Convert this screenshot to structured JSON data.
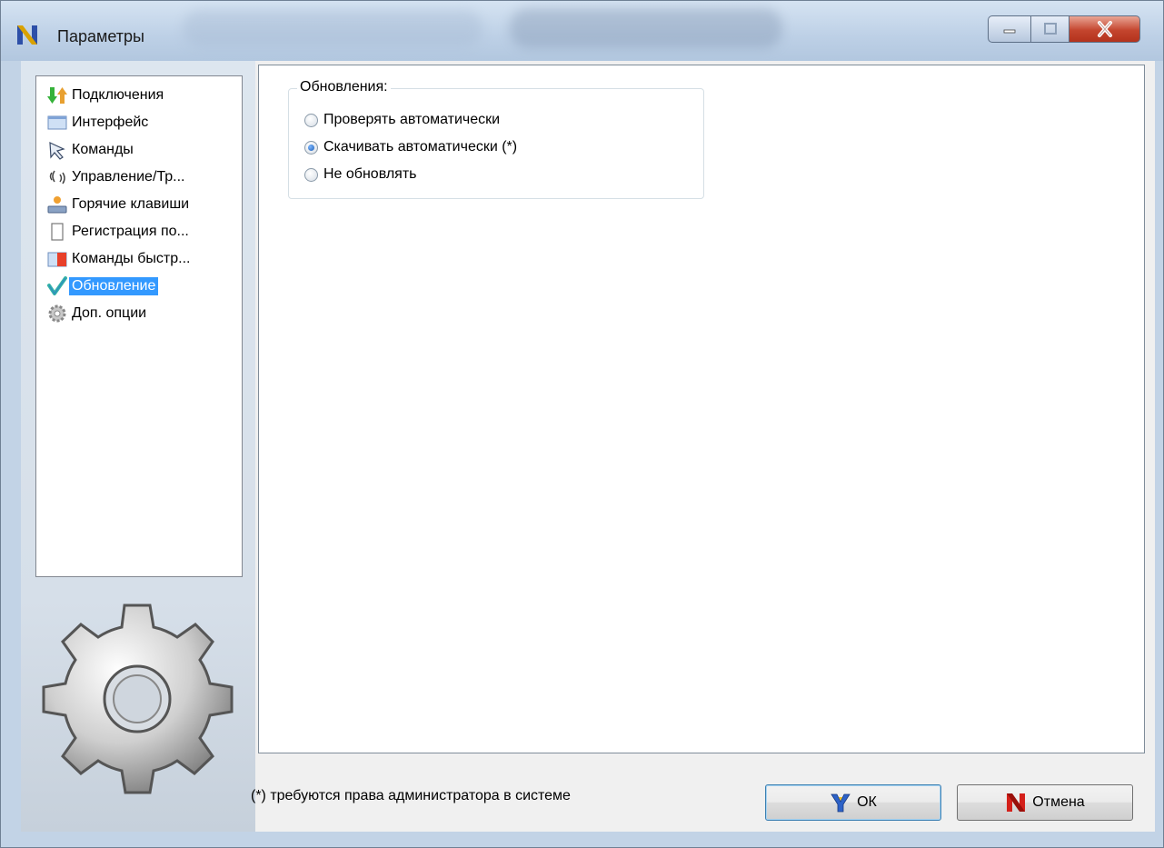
{
  "window": {
    "title": "Параметры",
    "icon": "app-n-icon",
    "controls": [
      "minimize-icon",
      "maximize-icon",
      "close-icon"
    ]
  },
  "sidebar": {
    "items": [
      {
        "label": "Подключения",
        "icon": "connections-arrows-icon",
        "selected": false
      },
      {
        "label": "Интерфейс",
        "icon": "interface-window-icon",
        "selected": false
      },
      {
        "label": "Команды",
        "icon": "commands-cursor-icon",
        "selected": false
      },
      {
        "label": "Управление/Тр...",
        "icon": "control-signal-icon",
        "selected": false
      },
      {
        "label": "Горячие клавиши",
        "icon": "hotkeys-icon",
        "selected": false
      },
      {
        "label": "Регистрация по...",
        "icon": "registration-icon",
        "selected": false
      },
      {
        "label": "Команды быстр...",
        "icon": "quick-commands-icon",
        "selected": false
      },
      {
        "label": "Обновление",
        "icon": "update-check-icon",
        "selected": true
      },
      {
        "label": "Доп. опции",
        "icon": "extra-options-gear-icon",
        "selected": false
      }
    ]
  },
  "updates": {
    "group_title": "Обновления:",
    "options": [
      {
        "label": "Проверять автоматически",
        "checked": false
      },
      {
        "label": "Скачивать автоматически (*)",
        "checked": true
      },
      {
        "label": "Не обновлять",
        "checked": false
      }
    ]
  },
  "footer": {
    "note": "(*) требуются права администратора в системе",
    "ok_label": "ОК",
    "cancel_label": "Отмена"
  },
  "colors": {
    "selection": "#3399ff",
    "close_button": "#c4452e"
  }
}
